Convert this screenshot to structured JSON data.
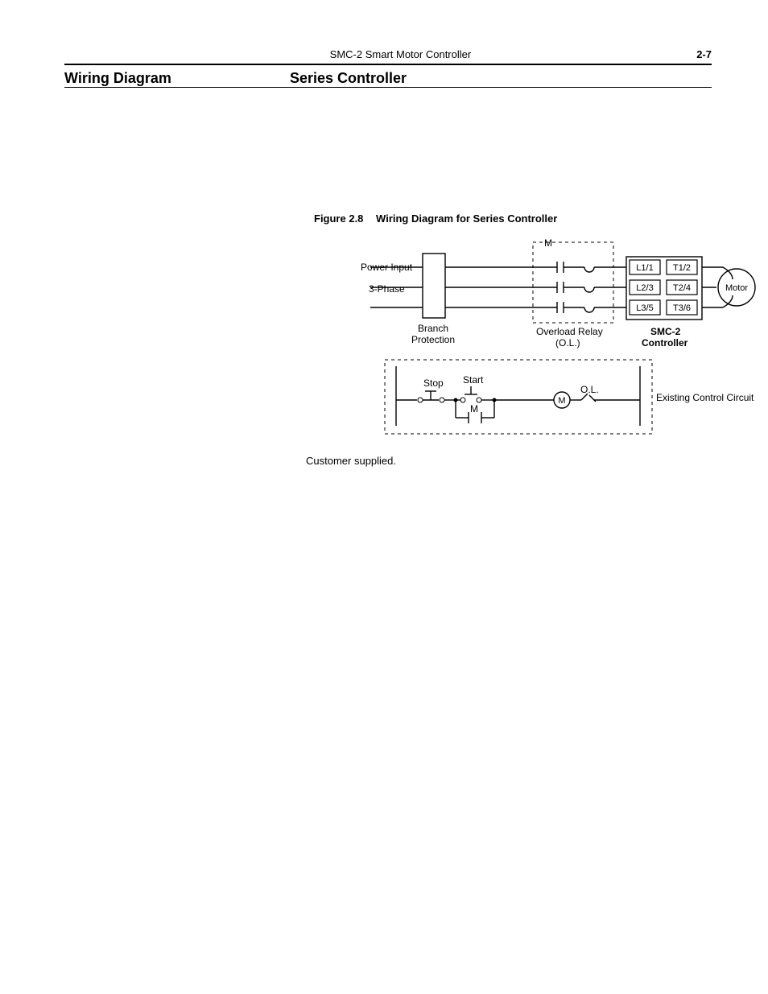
{
  "header": {
    "doc_title": "SMC-2 Smart Motor Controller",
    "page_no": "2-7"
  },
  "section": {
    "left": "Wiring Diagram",
    "right": "Series Controller"
  },
  "figure": {
    "caption_num": "Figure 2.8",
    "caption_text": "Wiring Diagram for Series Controller",
    "labels": {
      "power_input": "Power Input",
      "three_phase": "3-Phase",
      "branch_protection1": "Branch",
      "branch_protection2": "Protection",
      "m_top": "M",
      "overload1": "Overload Relay",
      "overload2": "(O.L.)",
      "controller1": "SMC-2",
      "controller2": "Controller",
      "motor": "Motor",
      "terms": {
        "l1": "L1/1",
        "l2": "L2/3",
        "l3": "L3/5",
        "t1": "T1/2",
        "t2": "T2/4",
        "t3": "T3/6"
      },
      "stop": "Stop",
      "start": "Start",
      "m_coil": "M",
      "ol_contact": "O.L.",
      "m_aux": "M",
      "existing": "Existing Control Circuit"
    },
    "footnote": "Customer supplied."
  }
}
